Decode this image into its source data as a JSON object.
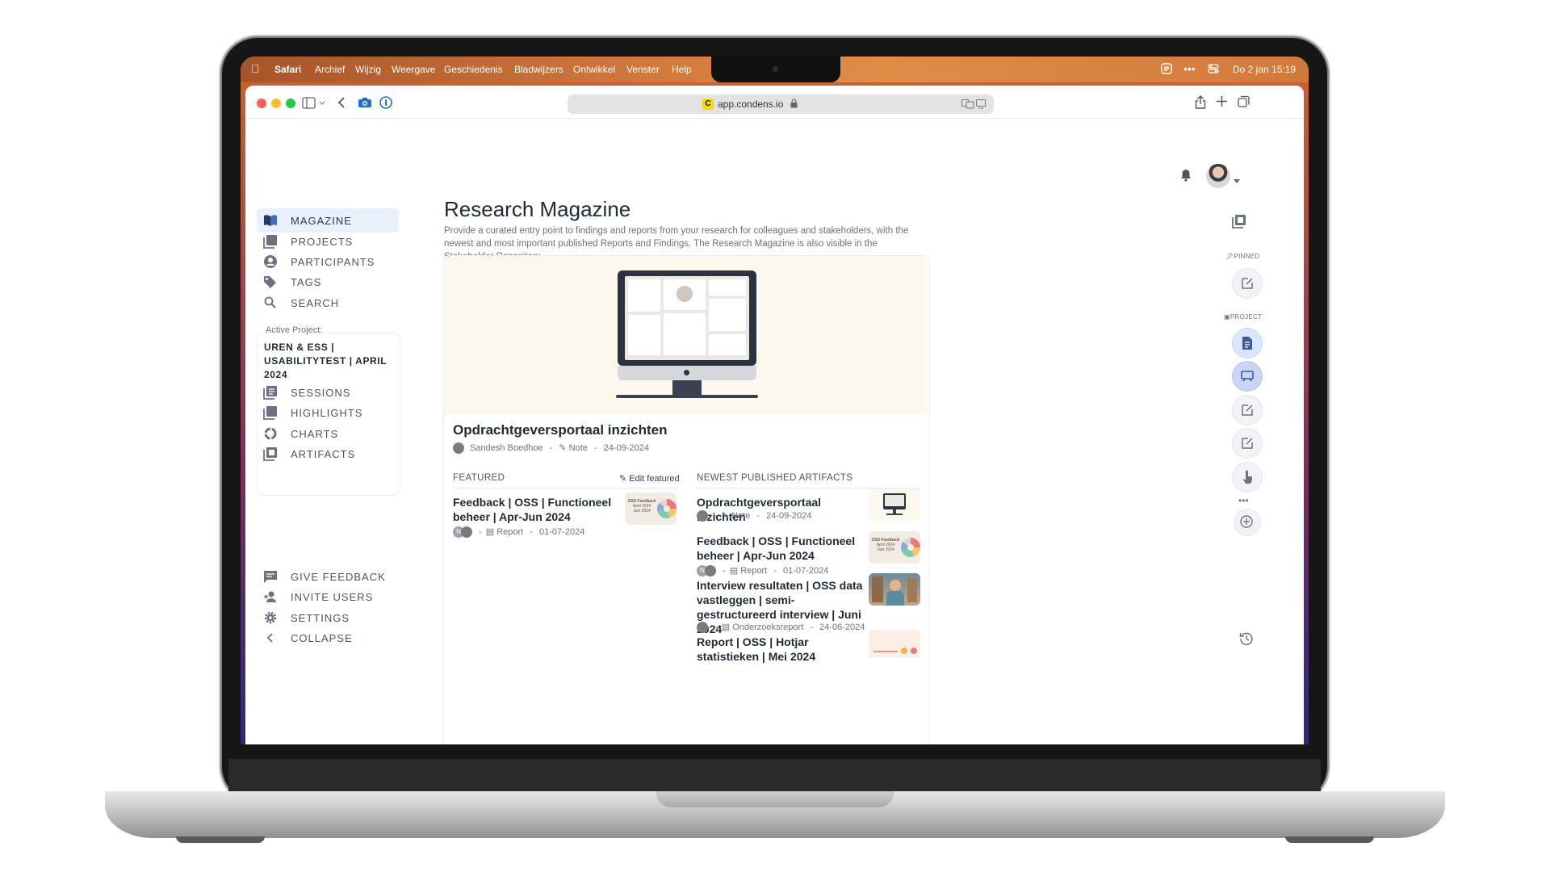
{
  "menubar": {
    "apple": "",
    "items": [
      "Safari",
      "Archief",
      "Wijzig",
      "Weergave",
      "Geschiedenis",
      "Bladwijzers",
      "Ontwikkel",
      "Venster",
      "Help"
    ],
    "clock": "Do 2 jan 15:19",
    "dots": "•••"
  },
  "browser": {
    "url": "app.condens.io",
    "favicon_letter": "C"
  },
  "sidebar": {
    "main_items": [
      "MAGAZINE",
      "PROJECTS",
      "PARTICIPANTS",
      "TAGS",
      "SEARCH"
    ],
    "active_project_label": "Active Project:",
    "active_project_name": "UREN & ESS | USABILITYTEST | APRIL 2024",
    "project_items": [
      "SESSIONS",
      "HIGHLIGHTS",
      "CHARTS",
      "ARTIFACTS"
    ],
    "bottom_items": [
      "GIVE FEEDBACK",
      "INVITE USERS",
      "SETTINGS",
      "COLLAPSE"
    ]
  },
  "page": {
    "title": "Research Magazine",
    "description": "Provide a curated entry point to findings and reports from your research for colleagues and stakeholders, with the newest and most important published Reports and Findings. The Research Magazine is also visible in the Stakeholder Repository."
  },
  "hero": {
    "title": "Opdrachtgeversportaal inzichten",
    "author": "Sandesh Boedhoe",
    "type": "Note",
    "date": "24-09-2024",
    "sep": "-"
  },
  "featured": {
    "header": "FEATURED",
    "edit_label": "Edit featured",
    "items": [
      {
        "title": "Feedback | OSS | Functioneel beheer | Apr-Jun 2024",
        "type": "Report",
        "date": "01-07-2024",
        "avatar_letter": "N",
        "thumb_line1": "OSS Feedback",
        "thumb_line2": "April 2024",
        "thumb_line3": "Juni 2024"
      }
    ]
  },
  "newest": {
    "header": "NEWEST PUBLISHED ARTIFACTS",
    "items": [
      {
        "title": "Opdrachtgeversportaal inzichten",
        "type": "Note",
        "date": "24-09-2024"
      },
      {
        "title": "Feedback | OSS | Functioneel beheer | Apr-Jun 2024",
        "type": "Report",
        "date": "01-07-2024",
        "avatar_letter": "N",
        "thumb_line1": "OSS Feedback",
        "thumb_line2": "April 2024",
        "thumb_line3": "Juni 2024"
      },
      {
        "title": "Interview resultaten | OSS data vastleggen | semi-gestructureerd interview | Juni 2024",
        "type": "Onderzoeksreport",
        "date": "24-06-2024"
      },
      {
        "title": "Report | OSS | Hotjar statistieken | Mei 2024",
        "type": "",
        "date": ""
      }
    ]
  },
  "right_rail": {
    "pinned_label": "PINNED",
    "project_label": "PROJECT",
    "more": "•••"
  },
  "colors": {
    "accent": "#1f3a68",
    "active_bg": "#e7f0fb",
    "hero_bg": "#fdf8ee"
  }
}
